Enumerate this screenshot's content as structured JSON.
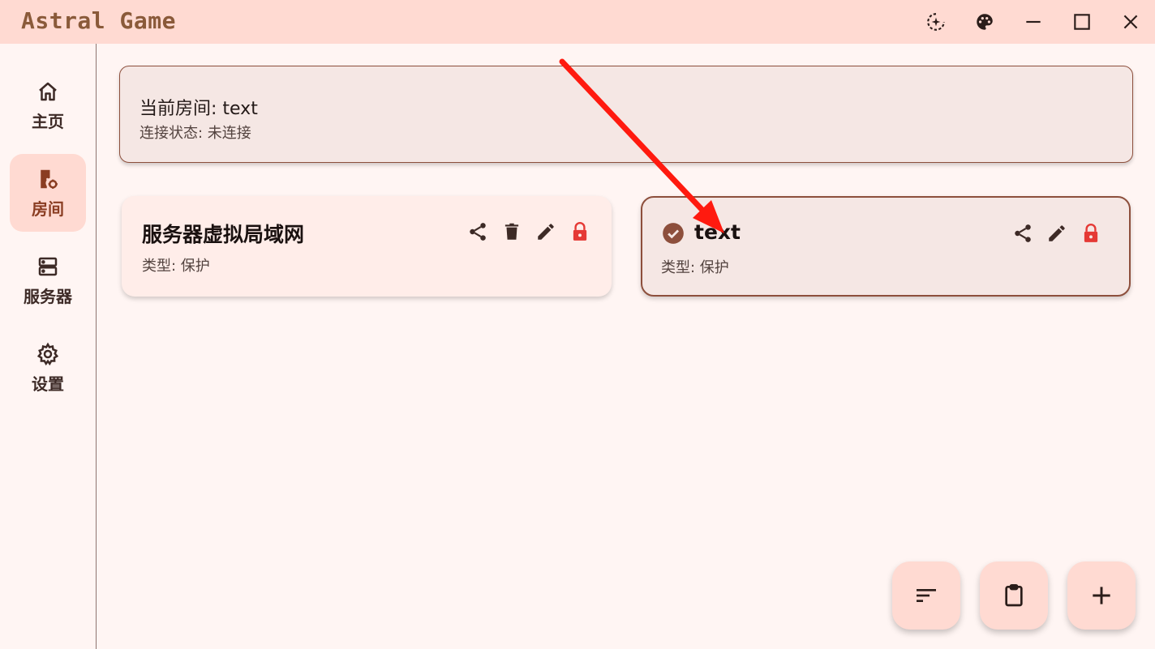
{
  "window": {
    "title": "Astral Game",
    "controls": [
      "ai-sparkle-icon",
      "palette-icon",
      "minimize-icon",
      "maximize-icon",
      "close-icon"
    ]
  },
  "sidebar": {
    "items": [
      {
        "label": "主页",
        "icon": "home-icon",
        "active": false
      },
      {
        "label": "房间",
        "icon": "room-door-settings-icon",
        "active": true
      },
      {
        "label": "服务器",
        "icon": "server-icon",
        "active": false
      },
      {
        "label": "设置",
        "icon": "gear-icon",
        "active": false
      }
    ]
  },
  "current_room": {
    "room_line": "当前房间: text",
    "status_line": "连接状态: 未连接"
  },
  "rooms": [
    {
      "name": "服务器虚拟局域网",
      "type_line": "类型: 保护",
      "selected": false,
      "actions": [
        "share-icon",
        "delete-icon",
        "edit-icon",
        "lock-icon"
      ]
    },
    {
      "name": "text",
      "type_line": "类型: 保护",
      "selected": true,
      "actions": [
        "share-icon",
        "edit-icon",
        "lock-icon"
      ]
    }
  ],
  "fabs": [
    "sort-icon",
    "clipboard-icon",
    "add-icon"
  ],
  "colors": {
    "titlebar": "#ffdad2",
    "accent": "#8d4f3c",
    "lock": "#e53935",
    "annotation_arrow": "#ff1a0f"
  }
}
